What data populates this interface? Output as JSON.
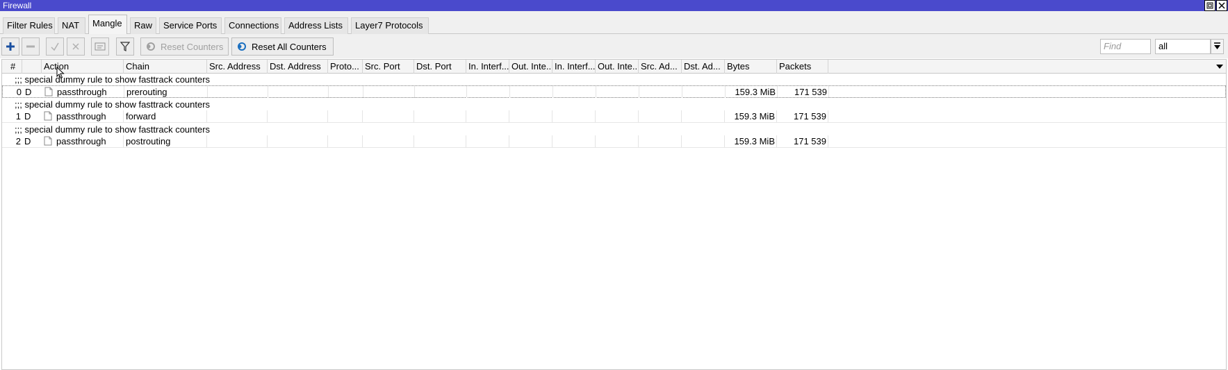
{
  "window": {
    "title": "Firewall"
  },
  "tabs": [
    {
      "label": "Filter Rules",
      "active": false
    },
    {
      "label": "NAT",
      "active": false
    },
    {
      "label": "Mangle",
      "active": true
    },
    {
      "label": "Raw",
      "active": false
    },
    {
      "label": "Service Ports",
      "active": false
    },
    {
      "label": "Connections",
      "active": false
    },
    {
      "label": "Address Lists",
      "active": false
    },
    {
      "label": "Layer7 Protocols",
      "active": false
    }
  ],
  "toolbar": {
    "add_icon": "plus-icon",
    "remove_icon": "minus-icon",
    "enable_icon": "check-icon",
    "disable_icon": "x-icon",
    "comment_icon": "comment-icon",
    "filter_icon": "funnel-icon",
    "reset_counters_label": "Reset Counters",
    "reset_all_counters_label": "Reset All Counters",
    "find_placeholder": "Find",
    "filter_value": "all"
  },
  "table": {
    "columns": [
      "#",
      "",
      "Action",
      "Chain",
      "Src. Address",
      "Dst. Address",
      "Proto...",
      "Src. Port",
      "Dst. Port",
      "In. Interf...",
      "Out. Inte...",
      "In. Interf...",
      "Out. Inte...",
      "Src. Ad...",
      "Dst. Ad...",
      "Bytes",
      "Packets"
    ],
    "rows": [
      {
        "comment": ";;; special dummy rule to show fasttrack counters",
        "num": "0",
        "flag": "D",
        "action": "passthrough",
        "chain": "prerouting",
        "bytes": "159.3 MiB",
        "packets": "171 539"
      },
      {
        "comment": ";;; special dummy rule to show fasttrack counters",
        "num": "1",
        "flag": "D",
        "action": "passthrough",
        "chain": "forward",
        "bytes": "159.3 MiB",
        "packets": "171 539"
      },
      {
        "comment": ";;; special dummy rule to show fasttrack counters",
        "num": "2",
        "flag": "D",
        "action": "passthrough",
        "chain": "postrouting",
        "bytes": "159.3 MiB",
        "packets": "171 539"
      }
    ]
  },
  "colors": {
    "titlebar": "#4a4acc",
    "accent_blue": "#1a4fa0"
  }
}
